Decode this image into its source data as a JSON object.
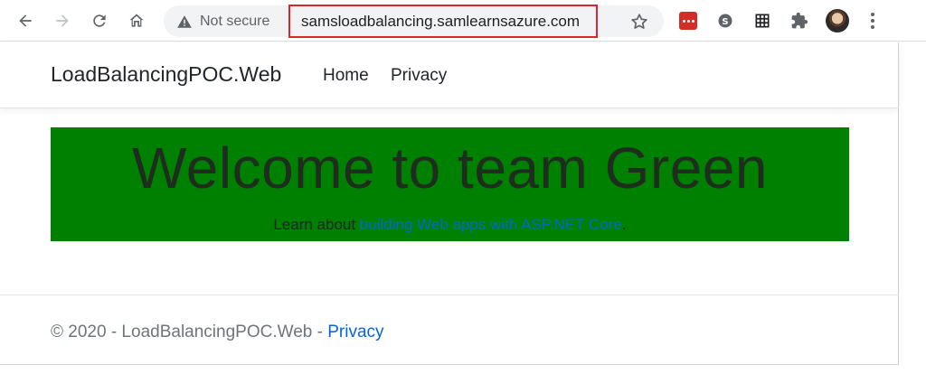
{
  "browser": {
    "security_label": "Not secure",
    "url": "samsloadbalancing.samlearnsazure.com",
    "icons": [
      "back-icon",
      "forward-icon",
      "reload-icon",
      "home-icon",
      "warning-icon",
      "star-icon",
      "lastpass-icon",
      "skype-icon",
      "grid-extension-icon",
      "puzzle-extensions-icon",
      "profile-avatar",
      "menu-icon"
    ],
    "accent_highlight": "#d9262f"
  },
  "navbar": {
    "brand": "LoadBalancingPOC.Web",
    "links": [
      "Home",
      "Privacy"
    ]
  },
  "jumbotron": {
    "heading": "Welcome to team Green",
    "lead_prefix": "Learn about ",
    "lead_link": "building Web apps with ASP.NET Core",
    "lead_suffix": ".",
    "background": "#008000"
  },
  "footer": {
    "copyright": "© 2020 - LoadBalancingPOC.Web - ",
    "privacy_link": "Privacy"
  }
}
